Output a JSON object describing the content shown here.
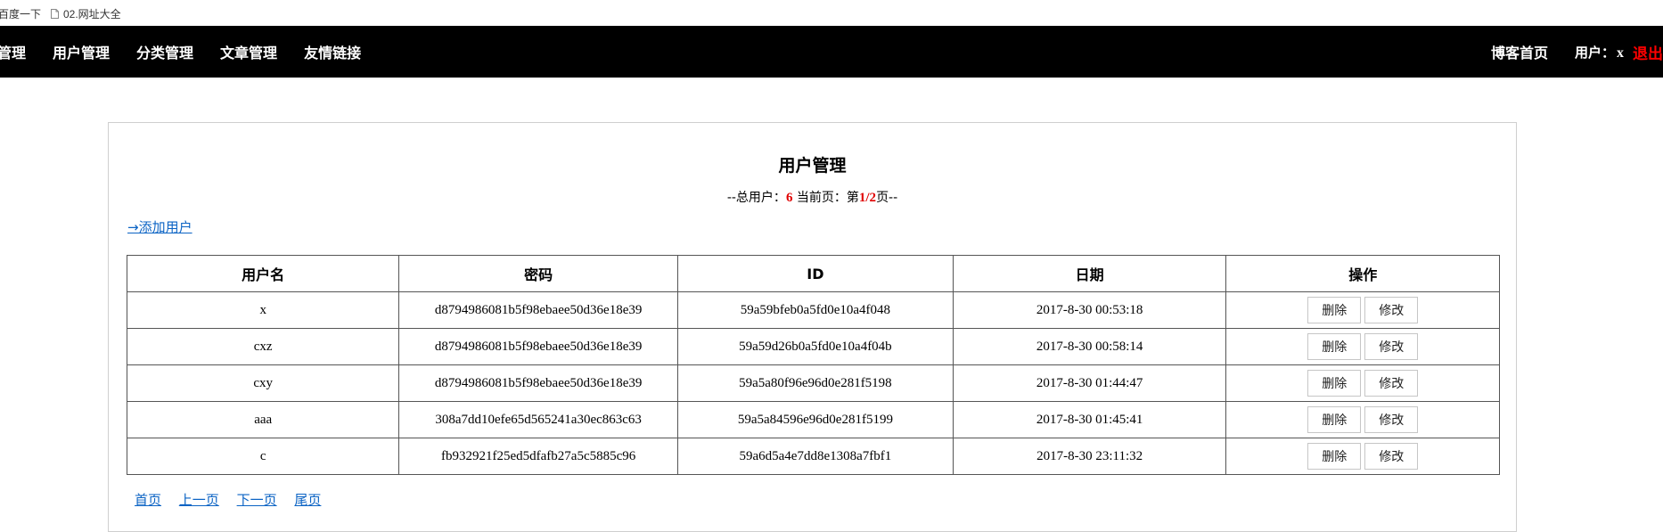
{
  "bookmarks": [
    {
      "label": "百度一下"
    },
    {
      "label": "02.网址大全",
      "icon": "document-icon"
    }
  ],
  "nav": {
    "items": [
      "管理",
      "用户管理",
      "分类管理",
      "文章管理",
      "友情链接"
    ],
    "home": "博客首页",
    "user_label": "用户：",
    "username": "x",
    "logout": "退出"
  },
  "page": {
    "title": "用户管理",
    "summary_prefix": "--总用户：",
    "total_users": "6",
    "summary_mid": " 当前页：第",
    "current_page": "1/2",
    "summary_suffix": "页--",
    "add_user": "→添加用户"
  },
  "table": {
    "headers": [
      "用户名",
      "密码",
      "ID",
      "日期",
      "操作"
    ],
    "rows": [
      {
        "username": "x",
        "password": "d8794986081b5f98ebaee50d36e18e39",
        "id": "59a59bfeb0a5fd0e10a4f048",
        "date": "2017-8-30 00:53:18"
      },
      {
        "username": "cxz",
        "password": "d8794986081b5f98ebaee50d36e18e39",
        "id": "59a59d26b0a5fd0e10a4f04b",
        "date": "2017-8-30 00:58:14"
      },
      {
        "username": "cxy",
        "password": "d8794986081b5f98ebaee50d36e18e39",
        "id": "59a5a80f96e96d0e281f5198",
        "date": "2017-8-30 01:44:47"
      },
      {
        "username": "aaa",
        "password": "308a7dd10efe65d565241a30ec863c63",
        "id": "59a5a84596e96d0e281f5199",
        "date": "2017-8-30 01:45:41"
      },
      {
        "username": "c",
        "password": "fb932921f25ed5dfafb27a5c5885c96",
        "id": "59a6d5a4e7dd8e1308a7fbf1",
        "date": "2017-8-30 23:11:32"
      }
    ],
    "delete_label": "删除",
    "edit_label": "修改"
  },
  "pager": {
    "first": "首页",
    "prev": "上一页",
    "next": "下一页",
    "last": "尾页"
  }
}
